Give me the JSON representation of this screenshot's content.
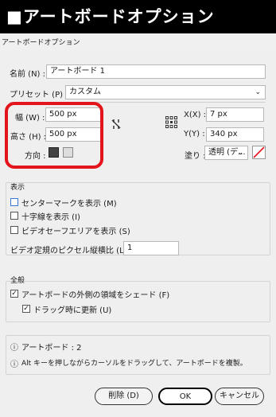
{
  "banner": {
    "title": "■アートボードオプション"
  },
  "window": {
    "title": "アートボードオプション"
  },
  "name": {
    "label": "名前 (N) :",
    "value": "アートボード 1"
  },
  "preset": {
    "label": "プリセット (P) :",
    "value": "カスタム"
  },
  "size": {
    "width_label": "幅 (W) :",
    "width_value": "500 px",
    "height_label": "高さ (H) :",
    "height_value": "500 px",
    "orientation_label": "方向 :"
  },
  "position": {
    "x_label": "X(X) :",
    "x_value": "7 px",
    "y_label": "Y(Y) :",
    "y_value": "340 px"
  },
  "fill": {
    "label": "塗り :",
    "value": "透明 (デ..."
  },
  "display": {
    "heading": "表示",
    "center_mark": "センターマークを表示 (M)",
    "crosshair": "十字線を表示 (I)",
    "video_safe": "ビデオセーフエリアを表示 (S)",
    "pixel_ratio_label": "ビデオ定規のピクセル縦横比 (L) :",
    "pixel_ratio_value": "1"
  },
  "general": {
    "heading": "全般",
    "shade_outside": "アートボードの外側の領域をシェード (F)",
    "update_drag": "ドラッグ時に更新 (U)"
  },
  "info": {
    "artboards": "アートボード : 2",
    "hint": "Alt キーを押しながらカーソルをドラッグして、アートボードを複製。"
  },
  "buttons": {
    "delete": "削除 (D)",
    "ok": "OK",
    "cancel": "キャンセル"
  },
  "colors": {
    "highlight": "#e3141b",
    "accent": "#3a76d8"
  }
}
